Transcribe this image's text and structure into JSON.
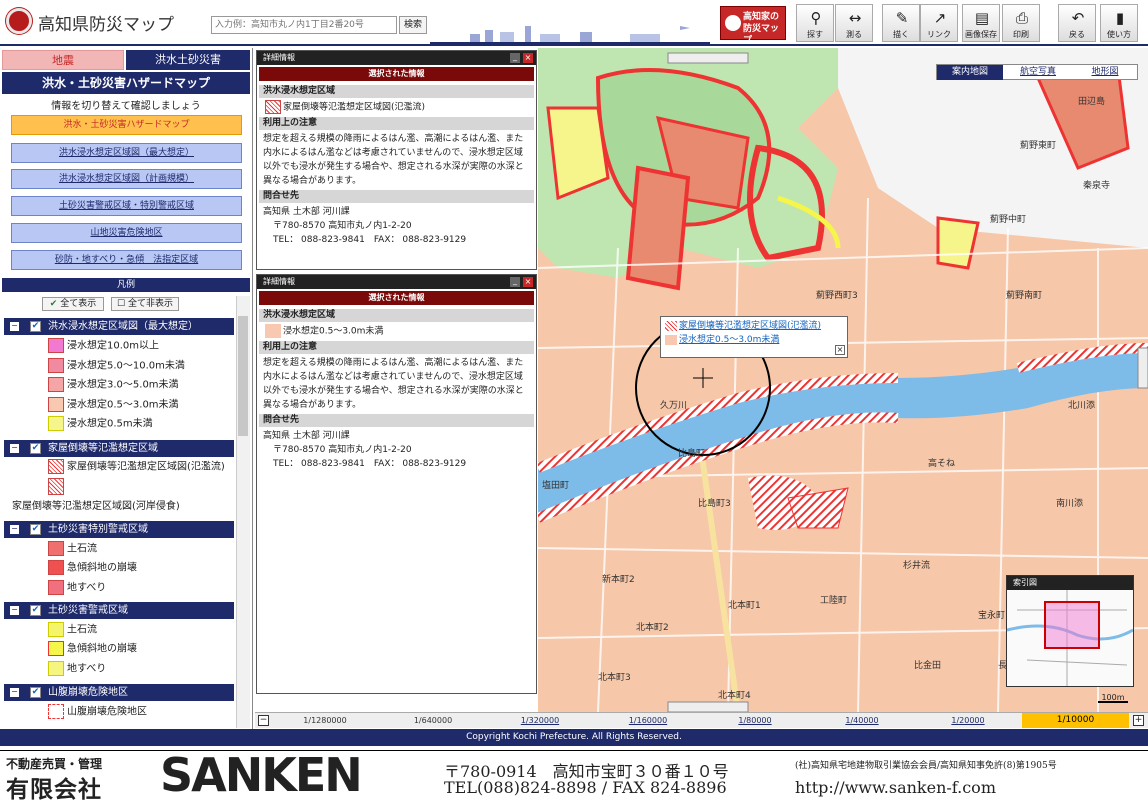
{
  "header": {
    "app_title": "高知県防災マップ",
    "search_placeholder": "入力例：高知市丸ノ内1丁目2番20号",
    "search_button": "検索",
    "kochi_button": "高知家の\n防災マップ",
    "tools": [
      {
        "label": "探す",
        "icon": "magnifier-icon"
      },
      {
        "label": "測る",
        "icon": "ruler-icon"
      },
      {
        "label": "描く",
        "icon": "draw-icon"
      },
      {
        "label": "リンク",
        "icon": "link-icon"
      },
      {
        "label": "画像保存",
        "icon": "save-image-icon"
      },
      {
        "label": "印刷",
        "icon": "printer-icon"
      },
      {
        "label": "戻る",
        "icon": "back-icon"
      },
      {
        "label": "使い方",
        "icon": "help-icon"
      }
    ]
  },
  "left": {
    "tab_earthquake": "地震",
    "tab_flood": "洪水土砂災害",
    "title": "洪水・土砂災害ハザードマップ",
    "subtitle": "情報を切り替えて確認しましょう",
    "buttons": [
      "洪水・土砂災害ハザードマップ",
      "洪水浸水想定区域図（最大想定）",
      "洪水浸水想定区域図（計画規模）",
      "土砂災害警戒区域・特別警戒区域",
      "山地災害危険地区",
      "砂防・地すべり・急傾　法指定区域"
    ],
    "legend_title": "凡例",
    "show_all": "全て表示",
    "hide_all": "全て非表示",
    "groups": [
      {
        "title": "洪水浸水想定区域図（最大想定）",
        "items": [
          {
            "label": "浸水想定10.0m以上",
            "color": "#f07ad0"
          },
          {
            "label": "浸水想定5.0〜10.0m未満",
            "color": "#f08aa0"
          },
          {
            "label": "浸水想定3.0〜5.0m未満",
            "color": "#f5a5a5"
          },
          {
            "label": "浸水想定0.5〜3.0m未満",
            "color": "#f8c9b0"
          },
          {
            "label": "浸水想定0.5m未満",
            "color": "#f5f58c"
          }
        ]
      },
      {
        "title": "家屋倒壊等氾濫想定区域",
        "items": [
          {
            "label": "家屋倒壊等氾濫想定区域図(氾濫流)",
            "color": "#ffffff"
          },
          {
            "label": "家屋倒壊等氾濫想定区域図(河岸侵食)",
            "color": "#ffffff"
          }
        ]
      },
      {
        "title": "土砂災害特別警戒区域",
        "items": [
          {
            "label": "土石流",
            "color": "#f07070"
          },
          {
            "label": "急傾斜地の崩壊",
            "color": "#f05050"
          },
          {
            "label": "地すべり",
            "color": "#f07080"
          }
        ]
      },
      {
        "title": "土砂災害警戒区域",
        "items": [
          {
            "label": "土石流",
            "color": "#f5f56a"
          },
          {
            "label": "急傾斜地の崩壊",
            "color": "#f5f54a"
          },
          {
            "label": "地すべり",
            "color": "#f5f580"
          }
        ]
      },
      {
        "title": "山腹崩壊危険地区",
        "items": [
          {
            "label": "山腹崩壊危険地区",
            "color": "#ffffff"
          }
        ]
      }
    ]
  },
  "panel1": {
    "header": "詳細情報",
    "selected": "選択された情報",
    "sec1": "洪水浸水想定区域",
    "item": "家屋倒壊等氾濫想定区域図(氾濫流)",
    "sec2": "利用上の注意",
    "note": "想定を超える規模の降雨によるはん濫、高潮によるはん濫、また内水によるはん濫などは考慮されていませんので、浸水想定区域以外でも浸水が発生する場合や、想定される水深が実際の水深と異なる場合があります。",
    "sec3": "問合せ先",
    "contact1": "高知県 土木部 河川課",
    "contact2": "〒780-8570 高知市丸ノ内1-2-20",
    "contact3": "TEL： 088-823-9841　FAX： 088-823-9129"
  },
  "panel2": {
    "header": "詳細情報",
    "selected": "選択された情報",
    "sec1": "洪水浸水想定区域",
    "item": "浸水想定0.5〜3.0m未満",
    "sec2": "利用上の注意",
    "note": "想定を超える規模の降雨によるはん濫、高潮によるはん濫、また内水によるはん濫などは考慮されていませんので、浸水想定区域以外でも浸水が発生する場合や、想定される水深が実際の水深と異なる場合があります。",
    "sec3": "問合せ先",
    "contact1": "高知県 土木部 河川課",
    "contact2": "〒780-8570 高知市丸ノ内1-2-20",
    "contact3": "TEL： 088-823-9841　FAX： 088-823-9129"
  },
  "map": {
    "modes": [
      "案内地図",
      "航空写真",
      "地形図"
    ],
    "popup_link1": "家屋倒壊等氾濫想定区域図(氾濫流)",
    "popup_link2": "浸水想定0.5〜3.0m未満",
    "popup_close": "×",
    "overview_title": "索引図",
    "scale": "100m",
    "labels": [
      "薊野東町",
      "薊野中町",
      "薊野西町3",
      "薊野南町",
      "久万川",
      "北川添",
      "比島町",
      "塩田町",
      "比島町3",
      "高そね",
      "南川添",
      "新本町2",
      "北本町1",
      "北本町3",
      "杉井流",
      "宝永町",
      "工陸町",
      "比金田",
      "北本町2",
      "長大工町",
      "田辺島",
      "北本町4",
      "秦泉寺"
    ]
  },
  "zoom": {
    "levels": [
      "1/1280000",
      "1/640000",
      "1/320000",
      "1/160000",
      "1/80000",
      "1/40000",
      "1/20000"
    ],
    "current": "1/10000",
    "minus": "−",
    "plus": "+"
  },
  "copyright": "Copyright Kochi Prefecture. All Rights Reserved.",
  "footer": {
    "line1": "不動産売買・管理",
    "company": "有限会社",
    "brand": "SANKEN",
    "address": "〒780-0914　高知市宝町３０番１０号",
    "tel": "TEL(088)824-8898 / FAX 824-8896",
    "member": "(社)高知県宅地建物取引業協会会員/高知県知事免許(8)第1905号",
    "url": "http://www.sanken-f.com"
  }
}
